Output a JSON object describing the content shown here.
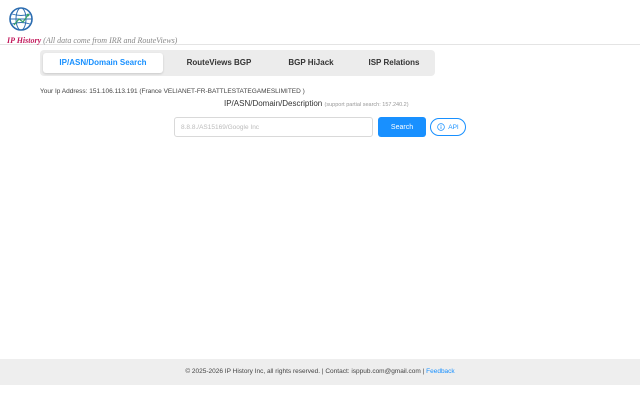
{
  "brand": {
    "name": "IP History",
    "note": "(All data come from IRR and RouteViews)"
  },
  "tabs": [
    {
      "label": "IP/ASN/Domain Search",
      "active": true
    },
    {
      "label": "RouteViews BGP",
      "active": false
    },
    {
      "label": "BGP HiJack",
      "active": false
    },
    {
      "label": "ISP Relations",
      "active": false
    }
  ],
  "ip_info": "Your Ip Address: 151.106.113.191 (France VELIANET-FR-BATTLESTATEGAMESLIMITED )",
  "search": {
    "title": "IP/ASN/Domain/Description",
    "hint": "(support partial search: 157.240.2)",
    "placeholder": "8.8.8./AS15169/Google Inc",
    "value": "",
    "button_label": "Search",
    "api_label": "API"
  },
  "footer": {
    "text": "© 2025-2026 IP History Inc, all rights reserved. | Contact: isppub.com@gmail.com | ",
    "feedback_label": "Feedback"
  },
  "colors": {
    "accent": "#1890ff",
    "brand": "#c2185b"
  },
  "icons": {
    "logo": "globe-icon",
    "api": "info-icon"
  }
}
